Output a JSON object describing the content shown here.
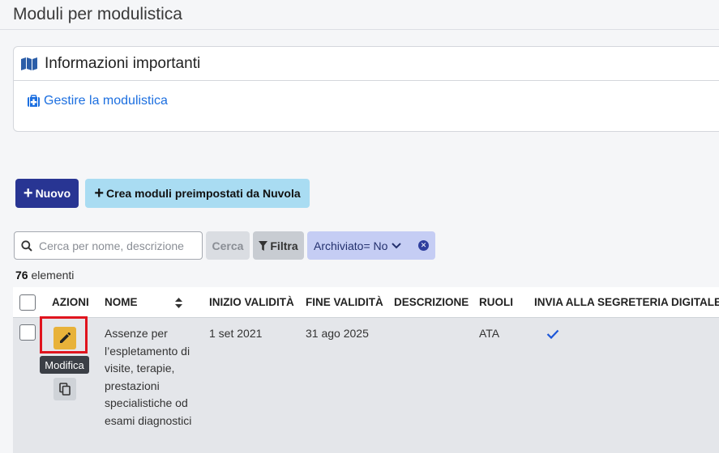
{
  "page": {
    "title": "Moduli per modulistica"
  },
  "info": {
    "heading": "Informazioni importanti",
    "heading_icon": "map-icon",
    "link_label": "Gestire la modulistica",
    "link_icon": "first-aid-icon"
  },
  "toolbar": {
    "new_label": "Nuovo",
    "preset_label": "Crea moduli preimpostati da Nuvola"
  },
  "search": {
    "placeholder": "Cerca per nome, descrizione",
    "value": "",
    "search_label": "Cerca",
    "filter_label": "Filtra"
  },
  "filter_chip": {
    "label": "Archiviato= No"
  },
  "count": {
    "number": "76",
    "label": " elementi"
  },
  "table": {
    "headers": {
      "azioni": "AZIONI",
      "nome": "NOME",
      "inizio": "INIZIO VALIDITÀ",
      "fine": "FINE VALIDITÀ",
      "descrizione": "DESCRIZIONE",
      "ruoli": "RUOLI",
      "invia": "INVIA ALLA SEGRETERIA DIGITALE?"
    },
    "rows": [
      {
        "nome_lines": [
          "Assenze per",
          "l’espletamento di",
          "visite, terapie,",
          "prestazioni",
          "specialistiche od",
          "esami diagnostici"
        ],
        "inizio": "1 set 2021",
        "fine": "31 ago 2025",
        "descrizione": "",
        "ruoli": "ATA",
        "invia": true
      }
    ]
  },
  "tooltip": {
    "text": "Modifica"
  },
  "colors": {
    "primary": "#283593",
    "secondary": "#a9dcf2",
    "edit": "#e8b23a",
    "highlight": "#e0141e",
    "link": "#1c6fe0",
    "check": "#1c56d8"
  }
}
